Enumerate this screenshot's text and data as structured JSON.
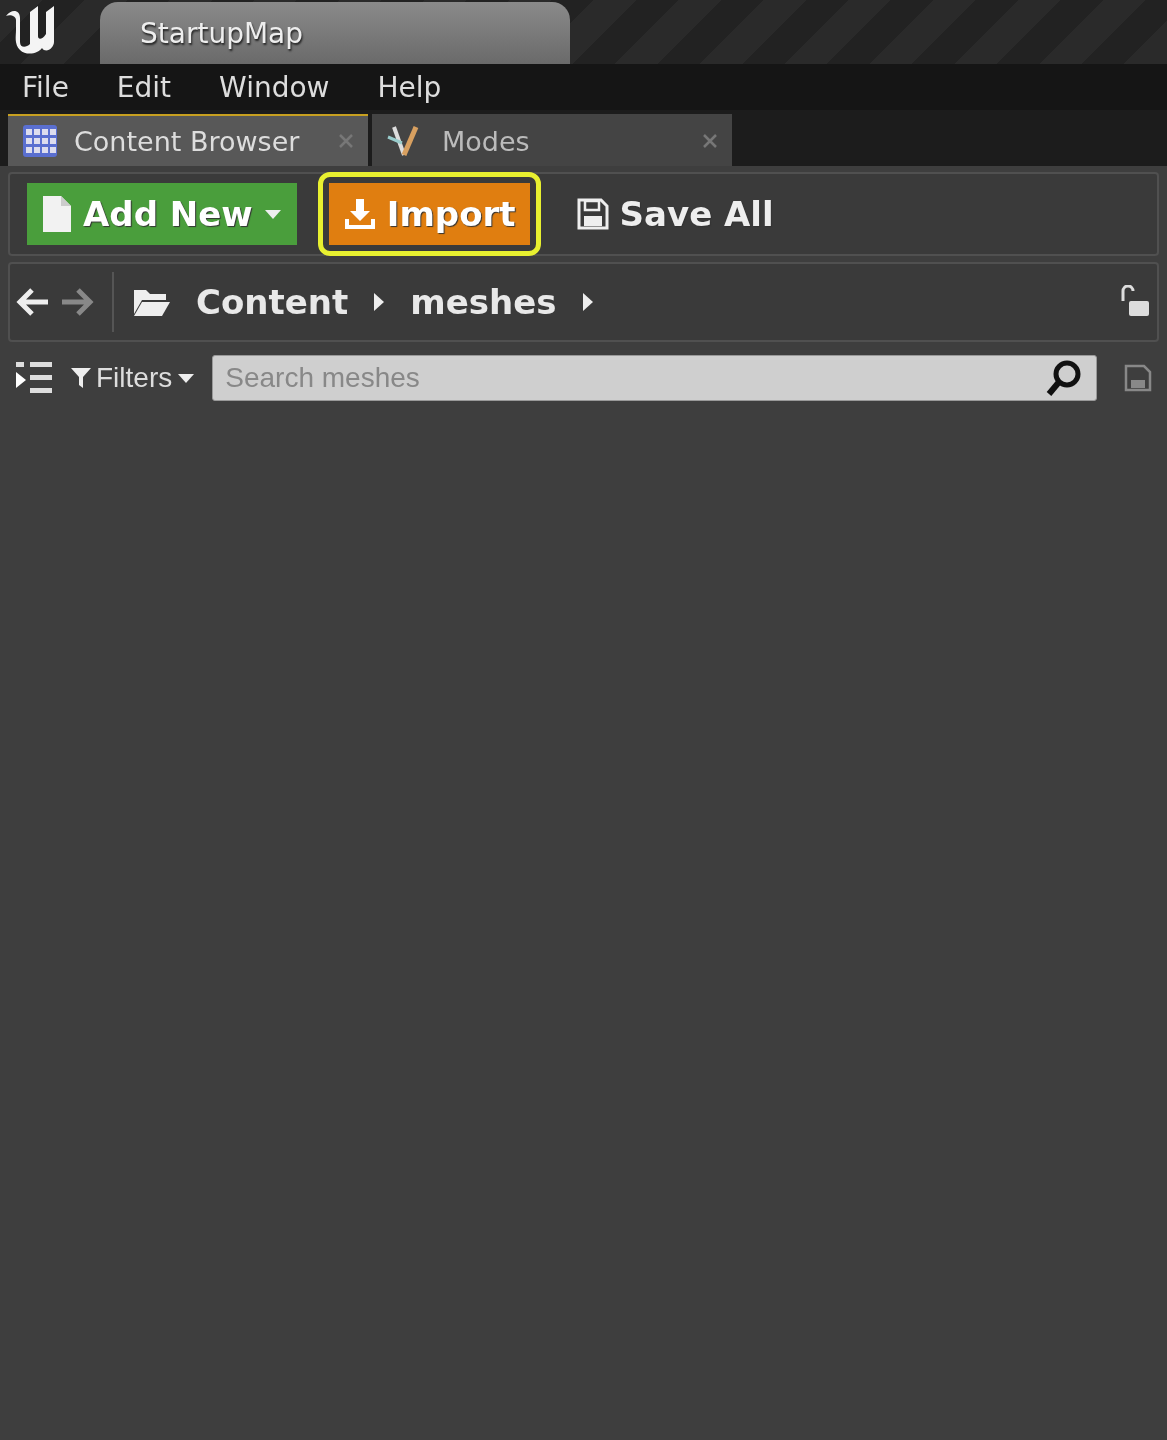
{
  "window": {
    "title": "StartupMap"
  },
  "menu": [
    "File",
    "Edit",
    "Window",
    "Help"
  ],
  "tabs": [
    {
      "label": "Content Browser",
      "selected": true,
      "kind": "grid"
    },
    {
      "label": "Modes",
      "selected": false,
      "kind": "tools"
    }
  ],
  "toolbar": [
    {
      "kind": "add",
      "label": "Add New",
      "highlighted": false
    },
    {
      "kind": "import",
      "label": "Import",
      "highlighted": true
    },
    {
      "kind": "save",
      "label": "Save All",
      "highlighted": false
    }
  ],
  "path": {
    "back_disabled": false,
    "forward_disabled": true,
    "crumbs": [
      "Content",
      "meshes"
    ]
  },
  "filters": {
    "label": "Filters",
    "search": {
      "placeholder": "Search meshes"
    }
  }
}
